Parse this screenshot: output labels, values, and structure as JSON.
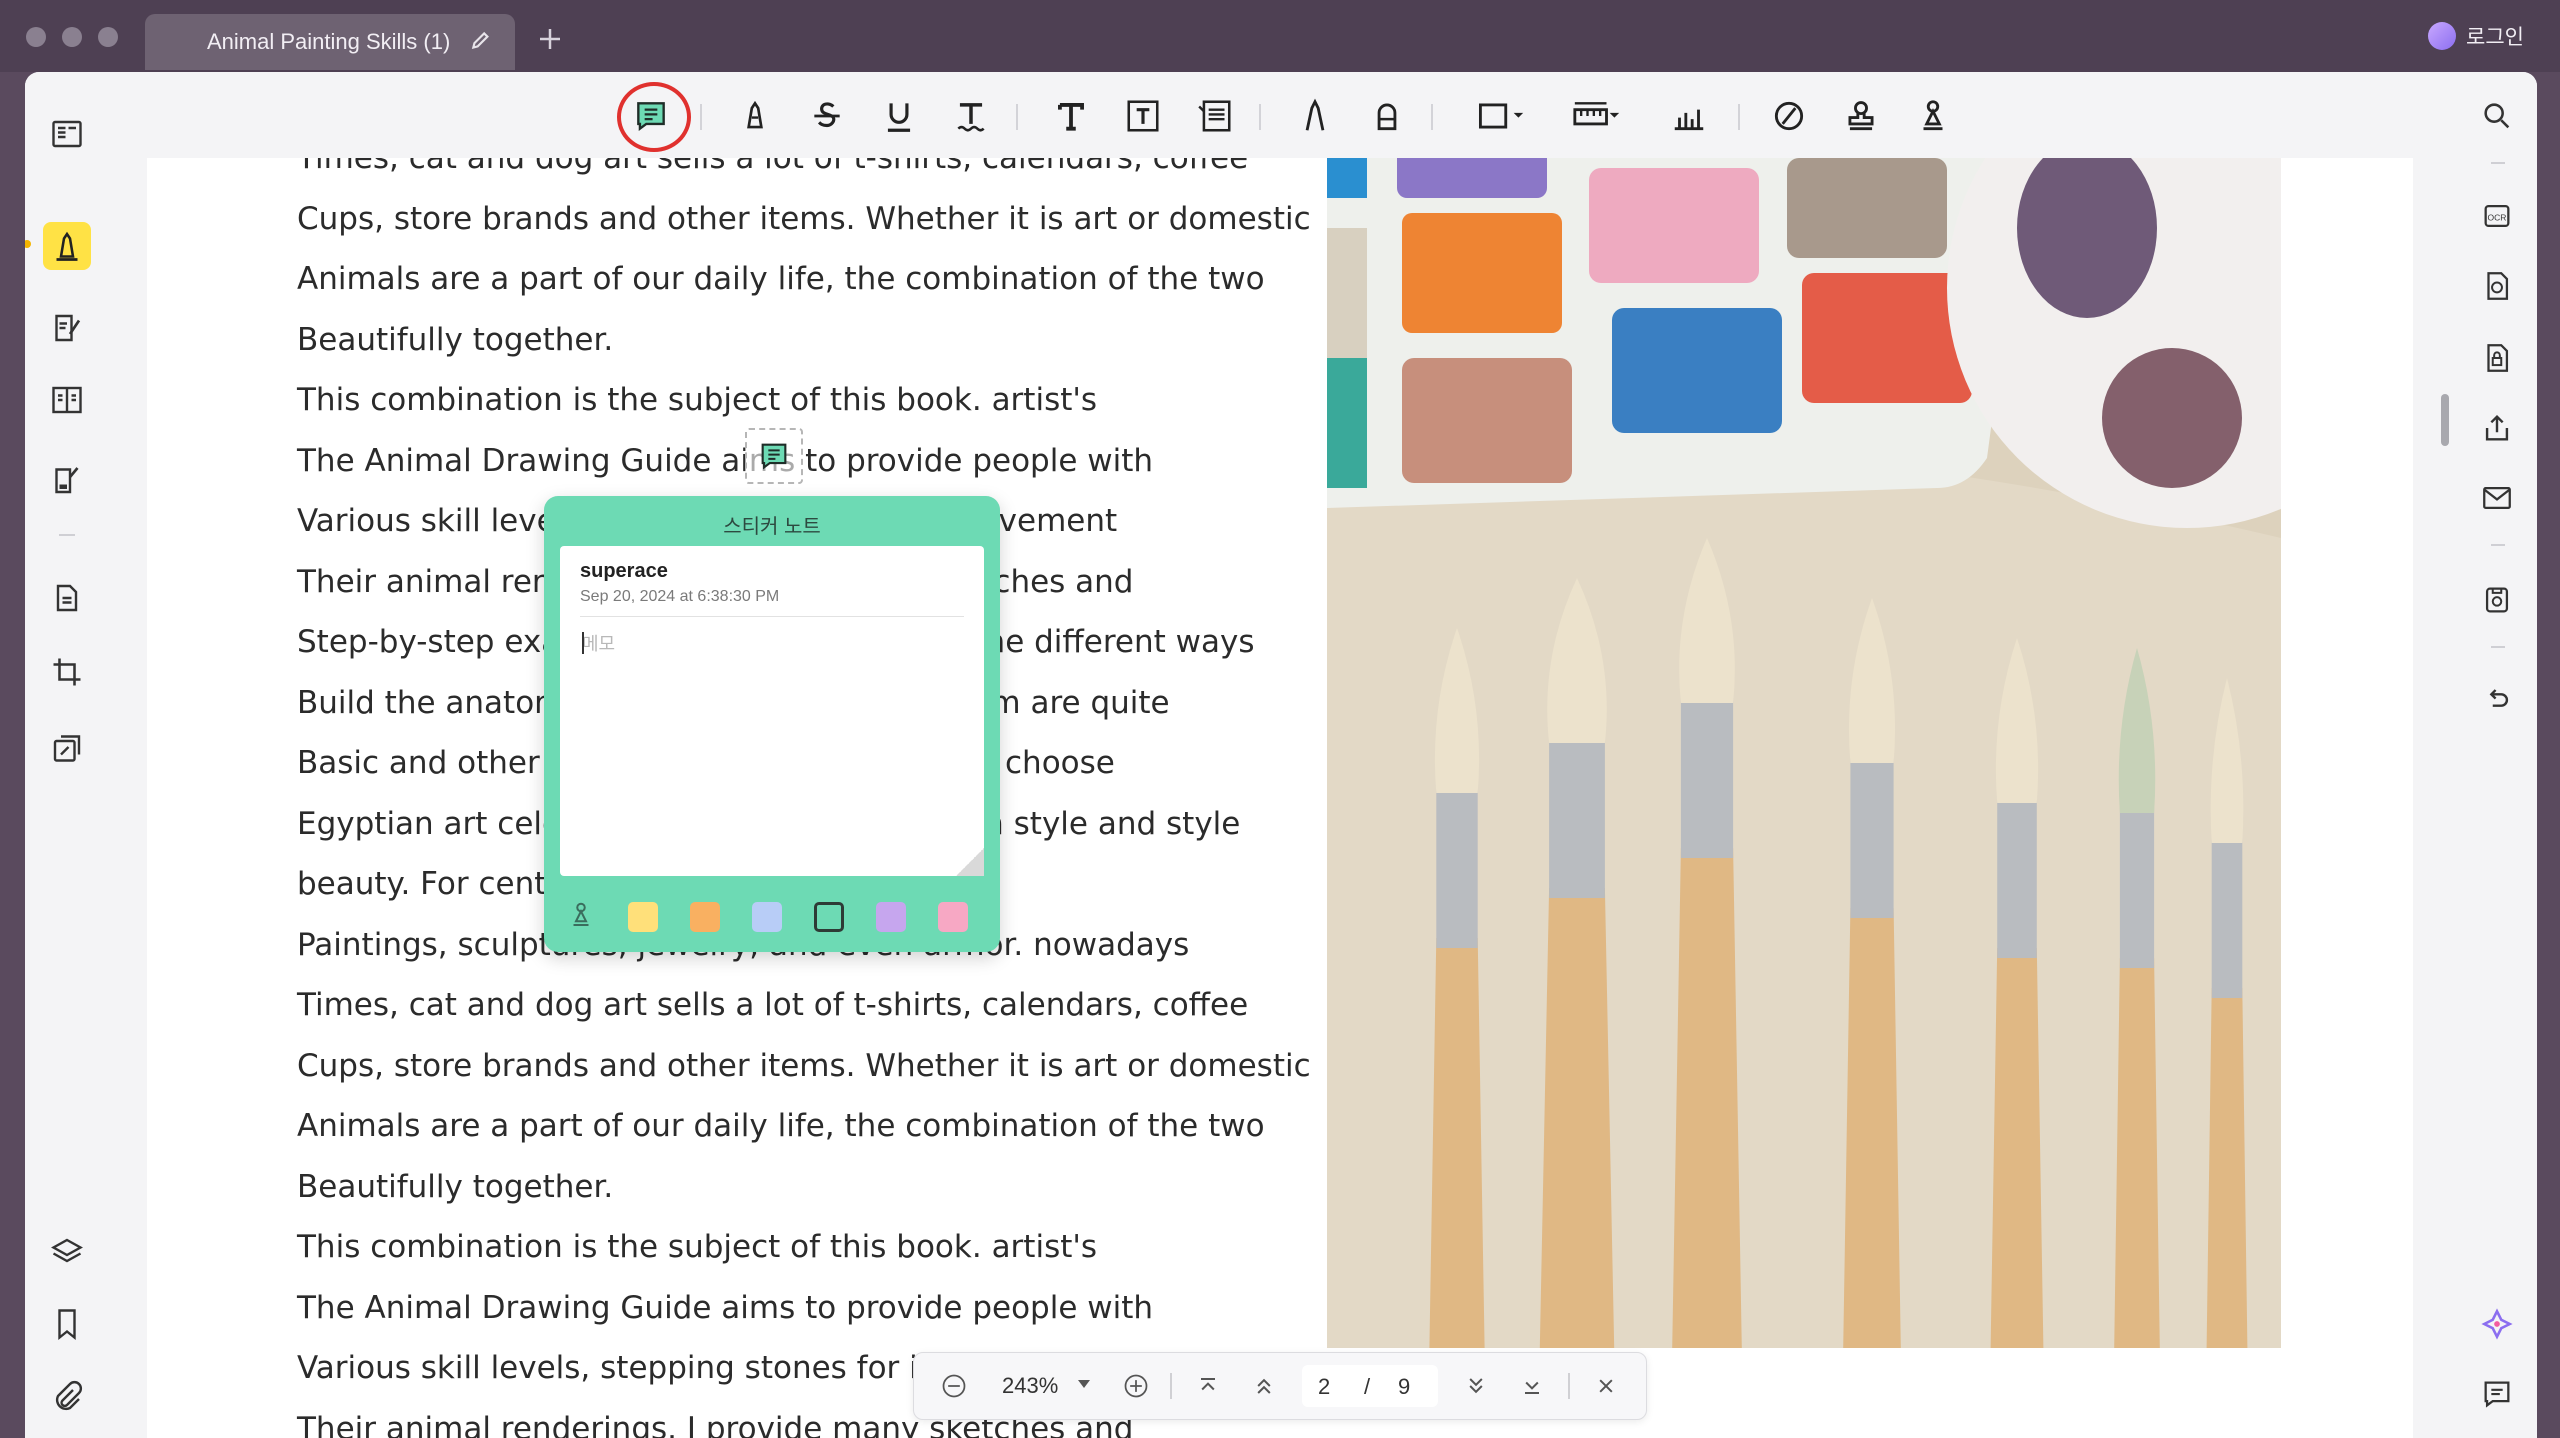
{
  "tab": {
    "title": "Animal Painting Skills (1)"
  },
  "account": {
    "login_label": "로그인"
  },
  "document": {
    "lines": [
      "Times, cat and dog art sells a lot of t-shirts, calendars, coffee",
      "Cups, store brands and other items. Whether it is art or domestic",
      "Animals are a part of our daily life, the combination of the two",
      "Beautifully together.",
      "This combination is the subject of this book. artist's",
      "The Animal Drawing Guide aims to provide people with",
      "Various skill levels, stepping stones for improvement",
      "Their animal renderings. I provide many sketches and",
      "Step-by-step examples to help readers see the different ways",
      "Build the anatomy of an animal. some of them are quite",
      "Basic and other more advanced ones. Please choose",
      "Egyptian art celebrates animals like cats with style and style",
      "beauty. For centuries, this horse has inspired",
      "Paintings, sculptures, jewelry, and even armor. nowadays",
      "Times, cat and dog art sells a lot of t-shirts, calendars, coffee",
      "Cups, store brands and other items. Whether it is art or domestic",
      "Animals are a part of our daily life, the combination of the two",
      "Beautifully together.",
      "This combination is the subject of this book. artist's",
      "The Animal Drawing Guide aims to provide people with",
      "Various skill levels, stepping stones for improvement",
      "Their animal renderings. I provide many sketches and"
    ]
  },
  "sticky_note": {
    "title": "스티커 노트",
    "author": "superace",
    "timestamp": "Sep 20, 2024 at 6:38:30 PM",
    "placeholder": "메모",
    "value": "",
    "colors": [
      "#ffe07a",
      "#f9b061",
      "#b8cdf7",
      "#6ddab4",
      "#c6a6ee",
      "#f7a8c4"
    ],
    "selected_color": "#6ddab4"
  },
  "pager": {
    "zoom": "243%",
    "current_page": "2",
    "separator": "/",
    "total_pages": "9"
  },
  "icons": {
    "toolbar": [
      "sticky-note-icon",
      "highlighter-icon",
      "strikethrough-icon",
      "underline-icon",
      "squiggly-text-icon",
      "text-icon",
      "text-box-icon",
      "callout-icon",
      "pencil-icon",
      "eraser-icon",
      "shape-icon",
      "measure-icon",
      "chart-icon",
      "signature-icon",
      "stamp-icon",
      "attachment-pen-icon"
    ],
    "left_rail": [
      "reader-icon",
      "comment-icon",
      "edit-pdf-icon",
      "organize-icon",
      "fill-sign-icon",
      "convert-icon",
      "crop-icon",
      "compress-icon",
      "layers-icon",
      "bookmark-icon",
      "attachment-icon"
    ],
    "right_rail": [
      "search-icon",
      "ocr-icon",
      "convert-pdf-icon",
      "protect-icon",
      "share-icon",
      "email-icon",
      "save-icon",
      "undo-icon",
      "ai-assistant-icon",
      "comments-panel-icon"
    ]
  },
  "colors": {
    "accent": "#ffe245",
    "sticky": "#6ddab4",
    "ring": "#e0312e"
  }
}
